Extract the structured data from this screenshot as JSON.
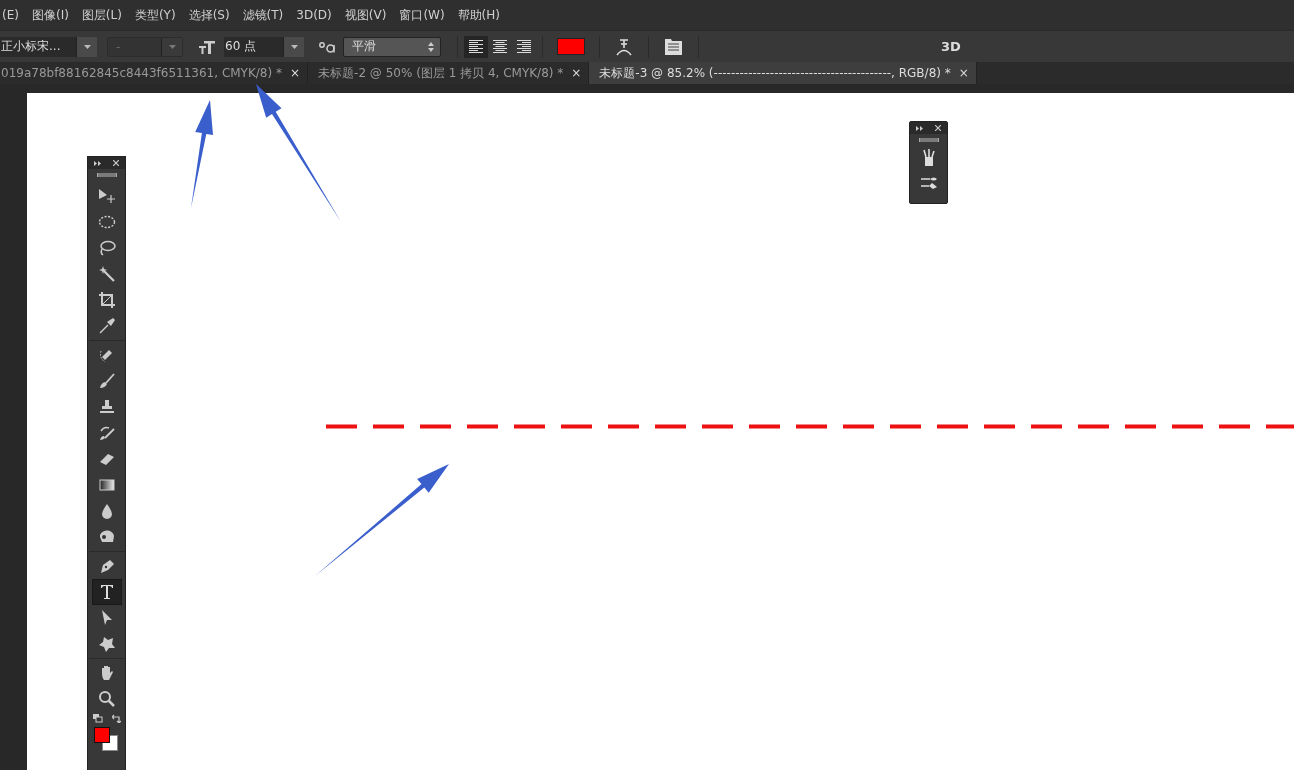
{
  "menu": [
    "(E)",
    "图像(I)",
    "图层(L)",
    "类型(Y)",
    "选择(S)",
    "滤镜(T)",
    "3D(D)",
    "视图(V)",
    "窗口(W)",
    "帮助(H)"
  ],
  "options_bar": {
    "font_family": {
      "value": "正小标宋...",
      "disabled": false
    },
    "font_style": {
      "value": "-",
      "disabled": true
    },
    "font_size": {
      "value": "60 点"
    },
    "antialias": {
      "value": "平滑"
    },
    "align": [
      {
        "kind": "left",
        "selected": true
      },
      {
        "kind": "center",
        "selected": false
      },
      {
        "kind": "right",
        "selected": false
      }
    ],
    "text_color": {
      "color": "#ff0000"
    },
    "mode_label": "3D"
  },
  "tabs": [
    {
      "title": "019a78bf88162845c8443f6511361, CMYK/8) *",
      "close": "×",
      "selected": false
    },
    {
      "title": "未标题-2 @ 50% (图层 1 拷贝 4, CMYK/8) *",
      "close": "×",
      "selected": false
    },
    {
      "title": "未标题-3 @ 85.2% (-----------------------------------------, RGB/8) *",
      "close": "×",
      "selected": true
    }
  ],
  "tools": [
    [
      {
        "kind": "move",
        "selected": false
      },
      {
        "kind": "marquee",
        "selected": false
      },
      {
        "kind": "lasso",
        "selected": false
      },
      {
        "kind": "wand",
        "selected": false
      },
      {
        "kind": "crop",
        "selected": false
      },
      {
        "kind": "eyedropper",
        "selected": false
      }
    ],
    [
      {
        "kind": "healing",
        "selected": false
      },
      {
        "kind": "brush",
        "selected": false
      },
      {
        "kind": "stamp",
        "selected": false
      },
      {
        "kind": "history",
        "selected": false
      },
      {
        "kind": "eraser",
        "selected": false
      },
      {
        "kind": "gradient",
        "selected": false
      },
      {
        "kind": "blur",
        "selected": false
      },
      {
        "kind": "dodge",
        "selected": false
      }
    ],
    [
      {
        "kind": "pen",
        "selected": false
      },
      {
        "kind": "text",
        "selected": true
      },
      {
        "kind": "path",
        "selected": false
      },
      {
        "kind": "shape",
        "selected": false
      }
    ],
    [
      {
        "kind": "hand",
        "selected": false
      },
      {
        "kind": "zoom",
        "selected": false
      }
    ]
  ],
  "swatches": [
    {
      "kind": "foreground",
      "color": "#ff0000"
    },
    {
      "kind": "background",
      "color": "#ffffff"
    }
  ]
}
